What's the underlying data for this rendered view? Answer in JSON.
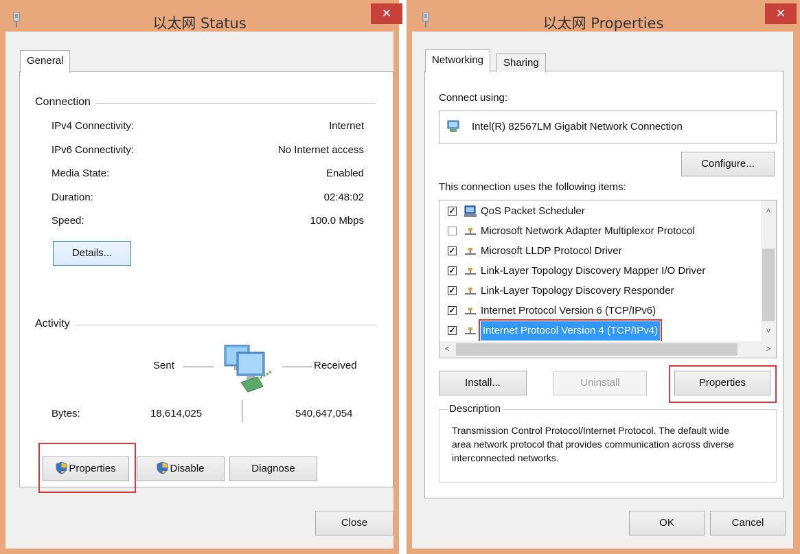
{
  "status_window": {
    "title": "以太网 Status",
    "close_glyph": "✕",
    "tabs": [
      "General"
    ],
    "connection": {
      "heading": "Connection",
      "rows": [
        {
          "label": "IPv4 Connectivity:",
          "value": "Internet"
        },
        {
          "label": "IPv6 Connectivity:",
          "value": "No Internet access"
        },
        {
          "label": "Media State:",
          "value": "Enabled"
        },
        {
          "label": "Duration:",
          "value": "02:48:02"
        },
        {
          "label": "Speed:",
          "value": "100.0 Mbps"
        }
      ],
      "details_button": "Details..."
    },
    "activity": {
      "heading": "Activity",
      "sent_label": "Sent",
      "received_label": "Received",
      "bytes_label": "Bytes:",
      "sent_value": "18,614,025",
      "received_value": "540,647,054"
    },
    "buttons": {
      "properties": "Properties",
      "disable": "Disable",
      "diagnose": "Diagnose",
      "close": "Close"
    }
  },
  "properties_window": {
    "title": "以太网 Properties",
    "close_glyph": "✕",
    "tabs": [
      "Networking",
      "Sharing"
    ],
    "connect_using_label": "Connect using:",
    "adapter_name": "Intel(R) 82567LM Gigabit Network Connection",
    "configure_button": "Configure...",
    "items_label": "This connection uses the following items:",
    "items": [
      {
        "label": "QoS Packet Scheduler",
        "checked": true,
        "icon": "qos-scheduler-icon"
      },
      {
        "label": "Microsoft Network Adapter Multiplexor Protocol",
        "checked": false,
        "icon": "protocol-icon"
      },
      {
        "label": "Microsoft LLDP Protocol Driver",
        "checked": true,
        "icon": "protocol-icon"
      },
      {
        "label": "Link-Layer Topology Discovery Mapper I/O Driver",
        "checked": true,
        "icon": "protocol-icon"
      },
      {
        "label": "Link-Layer Topology Discovery Responder",
        "checked": true,
        "icon": "protocol-icon"
      },
      {
        "label": "Internet Protocol Version 6 (TCP/IPv6)",
        "checked": true,
        "icon": "protocol-icon"
      },
      {
        "label": "Internet Protocol Version 4 (TCP/IPv4)",
        "checked": true,
        "icon": "protocol-icon",
        "selected": true
      }
    ],
    "buttons": {
      "install": "Install...",
      "uninstall": "Uninstall",
      "properties": "Properties",
      "ok": "OK",
      "cancel": "Cancel"
    },
    "description_heading": "Description",
    "description_text": "Transmission Control Protocol/Internet Protocol. The default wide area network protocol that provides communication across diverse interconnected networks."
  },
  "colors": {
    "title_bar": "#e8a87c",
    "close_button": "#c7403a",
    "selection": "#3399ff",
    "highlight_box": "#d9393a"
  }
}
